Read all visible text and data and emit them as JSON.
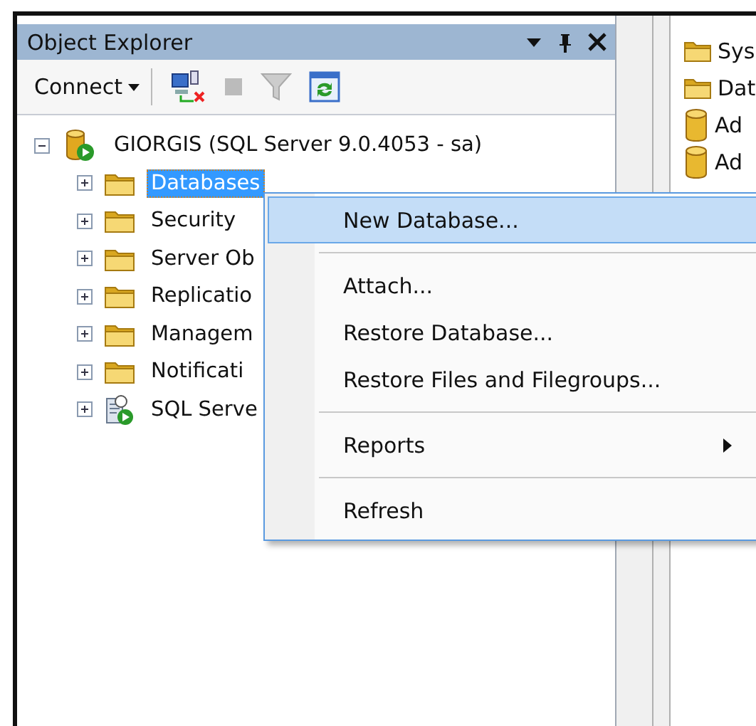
{
  "panel": {
    "title": "Object Explorer",
    "toolbar": {
      "connect": "Connect"
    },
    "tree": {
      "label": "GIORGIS (SQL Server 9.0.4053 - sa)",
      "kind": "server",
      "expanded": true,
      "children": [
        {
          "label": "Databases",
          "kind": "folder",
          "selected": true
        },
        {
          "label": "Security",
          "kind": "folder",
          "selected": false
        },
        {
          "label": "Server Ob",
          "kind": "folder",
          "selected": false
        },
        {
          "label": "Replicatio",
          "kind": "folder",
          "selected": false
        },
        {
          "label": "Managem",
          "kind": "folder",
          "selected": false
        },
        {
          "label": "Notificati",
          "kind": "folder",
          "selected": false
        },
        {
          "label": "SQL Serve",
          "kind": "agent",
          "selected": false
        }
      ]
    }
  },
  "right_panel": {
    "items": [
      {
        "label": "Sys",
        "kind": "folder"
      },
      {
        "label": "Dat",
        "kind": "folder"
      },
      {
        "label": "Ad",
        "kind": "database"
      },
      {
        "label": "Ad",
        "kind": "database"
      }
    ]
  },
  "context_menu": {
    "groups": [
      [
        {
          "label": "New Database...",
          "selected": true,
          "submenu": false
        }
      ],
      [
        {
          "label": "Attach...",
          "selected": false,
          "submenu": false
        },
        {
          "label": "Restore Database...",
          "selected": false,
          "submenu": false
        },
        {
          "label": "Restore Files and Filegroups...",
          "selected": false,
          "submenu": false
        }
      ],
      [
        {
          "label": "Reports",
          "selected": false,
          "submenu": true
        }
      ],
      [
        {
          "label": "Refresh",
          "selected": false,
          "submenu": false
        }
      ]
    ]
  }
}
